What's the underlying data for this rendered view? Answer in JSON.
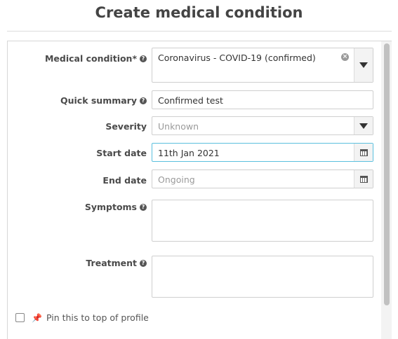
{
  "page": {
    "title": "Create medical condition"
  },
  "form": {
    "medical_condition": {
      "label": "Medical condition*",
      "value": "Coronavirus - COVID-19 (confirmed)"
    },
    "quick_summary": {
      "label": "Quick summary",
      "value": "Confirmed test"
    },
    "severity": {
      "label": "Severity",
      "placeholder": "Unknown"
    },
    "start_date": {
      "label": "Start date",
      "value": "11th Jan 2021"
    },
    "end_date": {
      "label": "End date",
      "placeholder": "Ongoing"
    },
    "symptoms": {
      "label": "Symptoms",
      "value": ""
    },
    "treatment": {
      "label": "Treatment",
      "value": ""
    }
  },
  "pin": {
    "label": "Pin this to top of profile",
    "checked": false
  },
  "icons": {
    "help": "question-circle-icon",
    "dropdown": "caret-down-icon",
    "calendar": "calendar-icon",
    "clear": "clear-icon",
    "pin": "pushpin-icon"
  },
  "colors": {
    "focus_border": "#5bc0de",
    "pin_icon": "#c9302c"
  }
}
